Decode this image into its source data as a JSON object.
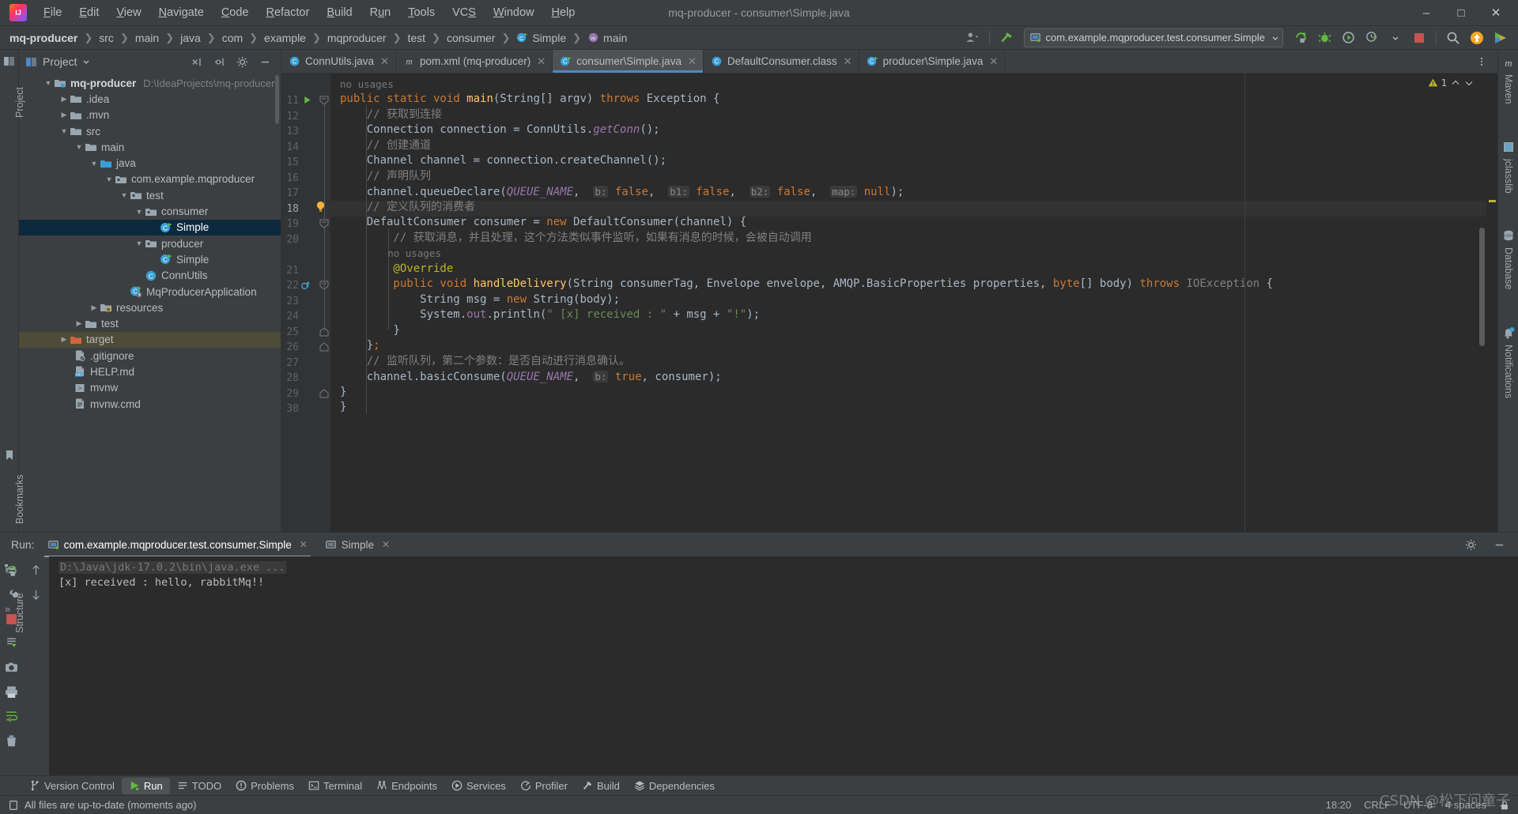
{
  "window": {
    "title": "mq-producer - consumer\\Simple.java",
    "minimize_label": "–",
    "maximize_label": "❑",
    "close_label": "✕"
  },
  "menubar": [
    {
      "label": "File",
      "mnemonic": "F"
    },
    {
      "label": "Edit",
      "mnemonic": "E"
    },
    {
      "label": "View",
      "mnemonic": "V"
    },
    {
      "label": "Navigate",
      "mnemonic": "N"
    },
    {
      "label": "Code",
      "mnemonic": "C"
    },
    {
      "label": "Refactor",
      "mnemonic": "R"
    },
    {
      "label": "Build",
      "mnemonic": "B"
    },
    {
      "label": "Run",
      "mnemonic": "u"
    },
    {
      "label": "Tools",
      "mnemonic": "T"
    },
    {
      "label": "VCS",
      "mnemonic": "S"
    },
    {
      "label": "Window",
      "mnemonic": "W"
    },
    {
      "label": "Help",
      "mnemonic": "H"
    }
  ],
  "navbar": {
    "crumbs": [
      {
        "label": "mq-producer",
        "bold": true,
        "icon": "none"
      },
      {
        "label": "src",
        "icon": "none"
      },
      {
        "label": "main",
        "icon": "none"
      },
      {
        "label": "java",
        "icon": "none"
      },
      {
        "label": "com",
        "icon": "none"
      },
      {
        "label": "example",
        "icon": "none"
      },
      {
        "label": "mqproducer",
        "icon": "none"
      },
      {
        "label": "test",
        "icon": "none"
      },
      {
        "label": "consumer",
        "icon": "none"
      },
      {
        "label": "Simple",
        "icon": "java-class-icon"
      },
      {
        "label": "main",
        "icon": "method-icon"
      }
    ],
    "separator": "❯",
    "run_config": "com.example.mqproducer.test.consumer.Simple",
    "icons": {
      "user": "user-icon",
      "chevron": "chevron-down-icon",
      "build": "hammer-icon",
      "run": "run-icon",
      "coverage": "run-with-coverage-icon",
      "debug": "debug-icon",
      "profile": "run-with-profiler-icon",
      "stop": "stop-icon",
      "search": "search-icon",
      "updates": "updates-icon",
      "ide_services": "ide-services-icon"
    }
  },
  "left_rail": {
    "items": [
      {
        "label": "Project",
        "icon": "project-icon"
      },
      {
        "label": "Bookmarks",
        "icon": "bookmarks-icon"
      },
      {
        "label": "Structure",
        "icon": "structure-icon"
      }
    ],
    "more": "»"
  },
  "right_rail": {
    "items": [
      {
        "label": "Maven",
        "icon": "maven-icon"
      },
      {
        "label": "jclasslib",
        "icon": "jclasslib-icon"
      },
      {
        "label": "Database",
        "icon": "database-icon"
      },
      {
        "label": "Notifications",
        "icon": "notifications-icon"
      }
    ]
  },
  "project_panel": {
    "title": "Project",
    "chevron": "chevron-down-icon",
    "actions": [
      "collapse-all-icon",
      "expand-all-icon",
      "settings-gear-icon",
      "hide-icon"
    ],
    "tree": [
      {
        "depth": 0,
        "arrow": "down",
        "icon": "module-folder-icon",
        "label": "mq-producer",
        "bold": true,
        "path": "D:\\IdeaProjects\\mq-producer"
      },
      {
        "depth": 1,
        "arrow": "right",
        "icon": "folder-icon",
        "label": ".idea"
      },
      {
        "depth": 1,
        "arrow": "right",
        "icon": "folder-icon",
        "label": ".mvn"
      },
      {
        "depth": 1,
        "arrow": "down",
        "icon": "folder-icon",
        "label": "src"
      },
      {
        "depth": 2,
        "arrow": "down",
        "icon": "folder-icon",
        "label": "main"
      },
      {
        "depth": 3,
        "arrow": "down",
        "icon": "source-folder-icon",
        "label": "java"
      },
      {
        "depth": 4,
        "arrow": "down",
        "icon": "package-icon",
        "label": "com.example.mqproducer"
      },
      {
        "depth": 5,
        "arrow": "down",
        "icon": "package-icon",
        "label": "test"
      },
      {
        "depth": 6,
        "arrow": "down",
        "icon": "package-icon",
        "label": "consumer"
      },
      {
        "depth": 7,
        "arrow": "none",
        "icon": "runnable-class-icon",
        "label": "Simple",
        "selected": true
      },
      {
        "depth": 6,
        "arrow": "down",
        "icon": "package-icon",
        "label": "producer"
      },
      {
        "depth": 7,
        "arrow": "none",
        "icon": "runnable-class-icon",
        "label": "Simple"
      },
      {
        "depth": 6,
        "arrow": "none",
        "icon": "class-icon",
        "label": "ConnUtils"
      },
      {
        "depth": 5,
        "arrow": "none",
        "icon": "spring-boot-class-icon",
        "label": "MqProducerApplication"
      },
      {
        "depth": 3,
        "arrow": "right",
        "icon": "resources-folder-icon",
        "label": "resources"
      },
      {
        "depth": 2,
        "arrow": "right",
        "icon": "folder-icon",
        "label": "test"
      },
      {
        "depth": 1,
        "arrow": "right",
        "icon": "target-folder-icon",
        "label": "target",
        "highlight": true
      },
      {
        "depth": 1,
        "arrow": "none",
        "icon": "gitignore-icon",
        "label": ".gitignore"
      },
      {
        "depth": 1,
        "arrow": "none",
        "icon": "markdown-icon",
        "label": "HELP.md"
      },
      {
        "depth": 1,
        "arrow": "none",
        "icon": "shell-script-icon",
        "label": "mvnw"
      },
      {
        "depth": 1,
        "arrow": "none",
        "icon": "cmd-file-icon",
        "label": "mvnw.cmd"
      }
    ]
  },
  "editor": {
    "tabs": [
      {
        "label": "ConnUtils.java",
        "icon": "java-class-icon",
        "active": false
      },
      {
        "label": "pom.xml (mq-producer)",
        "icon": "maven-file-icon",
        "active": false
      },
      {
        "label": "consumer\\Simple.java",
        "icon": "runnable-class-icon",
        "active": true
      },
      {
        "label": "DefaultConsumer.class",
        "icon": "java-class-icon",
        "active": false
      },
      {
        "label": "producer\\Simple.java",
        "icon": "runnable-class-icon",
        "active": false
      }
    ],
    "tab_close": "✕",
    "inspection": {
      "warning_count": "1",
      "warn_icon": "warning-triangle-icon",
      "up_icon": "chevron-up-icon",
      "down_icon": "chevron-down-icon"
    },
    "first_line_number": 11,
    "current_line": 18,
    "lines": [
      {
        "n": "",
        "inlay": "no usages"
      },
      {
        "n": "11",
        "gutter": "run-gutter-icon",
        "fold": "fold-end-icon"
      },
      {
        "n": "12"
      },
      {
        "n": "13"
      },
      {
        "n": "14"
      },
      {
        "n": "15"
      },
      {
        "n": "16"
      },
      {
        "n": "17"
      },
      {
        "n": "18",
        "gutter": "intention-bulb-icon",
        "current": true
      },
      {
        "n": "19",
        "fold": "fold-end-icon"
      },
      {
        "n": "20"
      },
      {
        "n": "",
        "inlay": "no usages"
      },
      {
        "n": "21"
      },
      {
        "n": "22",
        "gutter": "override-method-icon",
        "fold": "fold-end-icon"
      },
      {
        "n": "23"
      },
      {
        "n": "24"
      },
      {
        "n": "25",
        "fold": "fold-mid-icon"
      },
      {
        "n": "26",
        "fold": "fold-mid-icon"
      },
      {
        "n": "27"
      },
      {
        "n": "28"
      },
      {
        "n": "29",
        "fold": "fold-mid-icon"
      },
      {
        "n": "30"
      }
    ],
    "code_text": [
      "no usages",
      "public static void main(String[] argv) throws Exception {",
      "    // 获取到连接",
      "    Connection connection = ConnUtils.getConn();",
      "    // 创建通道",
      "    Channel channel = connection.createChannel();",
      "    // 声明队列",
      "    channel.queueDeclare(QUEUE_NAME,  b: false,  b1: false,  b2: false,  map: null);",
      "    // 定义队列的消费者",
      "    DefaultConsumer consumer = new DefaultConsumer(channel) {",
      "        // 获取消息，并且处理，这个方法类似事件监听，如果有消息的时候，会被自动调用",
      "        no usages",
      "        @Override",
      "        public void handleDelivery(String consumerTag, Envelope envelope, AMQP.BasicProperties properties, byte[] body) throws IOException {",
      "            String msg = new String(body);",
      "            System.out.println(\" [x] received : \" + msg + \"!\");",
      "        }",
      "    };",
      "    // 监听队列，第二个参数：是否自动进行消息确认。",
      "    channel.basicConsume(QUEUE_NAME,  b: true, consumer);",
      "}",
      "}"
    ]
  },
  "run_window": {
    "label": "Run:",
    "tabs": [
      {
        "label": "com.example.mqproducer.test.consumer.Simple",
        "icon": "run-config-icon",
        "active": true,
        "close": "✕"
      },
      {
        "label": "Simple",
        "icon": "console-icon",
        "active": false,
        "close": "✕"
      }
    ],
    "actions": [
      "settings-gear-icon",
      "hide-icon"
    ],
    "side_icons_left": [
      "rerun-icon",
      "wrench-icon",
      "stop-icon",
      "scroll-to-end-icon",
      "camera-icon",
      "print-icon",
      "soft-wrap-icon",
      "trash-icon"
    ],
    "side_icons_right": [
      "up-arrow-icon",
      "down-arrow-icon"
    ],
    "console": {
      "command": "D:\\Java\\jdk-17.0.2\\bin\\java.exe ...",
      "output": "  [x] received : hello, rabbitMq!!"
    }
  },
  "bottom_bar": {
    "items": [
      {
        "label": "Version Control",
        "icon": "version-control-icon",
        "active": false
      },
      {
        "label": "Run",
        "icon": "run-icon",
        "active": true
      },
      {
        "label": "TODO",
        "icon": "todo-icon",
        "active": false
      },
      {
        "label": "Problems",
        "icon": "problems-icon",
        "active": false
      },
      {
        "label": "Terminal",
        "icon": "terminal-icon",
        "active": false
      },
      {
        "label": "Endpoints",
        "icon": "endpoints-icon",
        "active": false
      },
      {
        "label": "Services",
        "icon": "services-icon",
        "active": false
      },
      {
        "label": "Profiler",
        "icon": "profiler-icon",
        "active": false
      },
      {
        "label": "Build",
        "icon": "build-icon",
        "active": false
      },
      {
        "label": "Dependencies",
        "icon": "dependencies-icon",
        "active": false
      }
    ]
  },
  "status_bar": {
    "message": "All files are up-to-date (moments ago)",
    "icon": "file-status-icon",
    "time": "18:20",
    "line_separator": "CRLF",
    "encoding": "UTF-8",
    "indent": "4 spaces",
    "lock_icon": "lock-icon"
  },
  "watermark": "CSDN @松下问童子",
  "colors": {
    "accent": "#4a88c7",
    "panel": "#3c3f41",
    "editor_bg": "#2b2b2b",
    "selection": "#0d293e",
    "keyword": "#cc7832",
    "string": "#6a8759",
    "comment": "#808080",
    "number": "#6897bb",
    "method": "#ffc66d",
    "annotation": "#bbb529",
    "warning": "#bbb529",
    "error": "#c75450",
    "target_highlight": "#4e4b38"
  }
}
